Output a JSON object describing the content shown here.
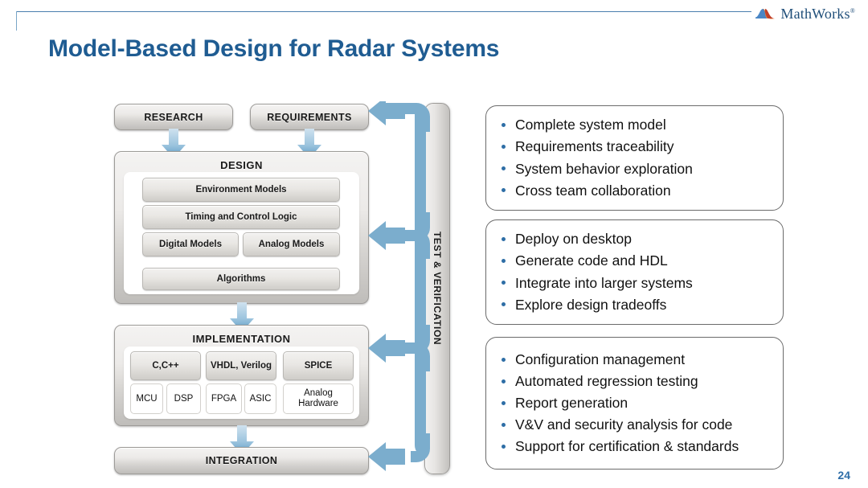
{
  "brand": {
    "name": "MathWorks",
    "trademark": "®",
    "logo_icon": "mathworks-membrane-icon",
    "accent_color": "#1f4e79"
  },
  "title": "Model-Based Design for Radar Systems",
  "page_number": "24",
  "colors": {
    "title": "#1f5c92",
    "arrow_blue": "#7badcd",
    "bullet_blue": "#2e6ea6",
    "box_border": "#9d9b98"
  },
  "diagram": {
    "inputs": [
      {
        "label": "RESEARCH"
      },
      {
        "label": "REQUIREMENTS"
      }
    ],
    "design": {
      "label": "DESIGN",
      "rows": [
        [
          "Environment Models"
        ],
        [
          "Timing and Control Logic"
        ],
        [
          "Digital Models",
          "Analog Models"
        ],
        [
          "Algorithms"
        ]
      ]
    },
    "implementation": {
      "label": "IMPLEMENTATION",
      "languages": [
        "C,C++",
        "VHDL, Verilog",
        "SPICE"
      ],
      "hardware": [
        "MCU",
        "DSP",
        "FPGA",
        "ASIC",
        "Analog\nHardware"
      ],
      "hardware_flat": [
        "MCU",
        "DSP",
        "FPGA",
        "ASIC",
        "Analog Hardware"
      ]
    },
    "integration": {
      "label": "INTEGRATION"
    },
    "verification": {
      "label": "TEST & VERIFICATION"
    },
    "flow_arrows": [
      "research-to-design",
      "requirements-to-design",
      "design-to-implementation",
      "implementation-to-integration"
    ],
    "feedback_arrows": [
      "verify-to-requirements",
      "verify-to-design",
      "verify-to-implementation",
      "verify-to-integration"
    ]
  },
  "panels": [
    {
      "name": "modeling-benefits",
      "bullets": [
        "Complete system model",
        "Requirements traceability",
        "System behavior exploration",
        "Cross team collaboration"
      ]
    },
    {
      "name": "implementation-benefits",
      "bullets": [
        "Deploy on desktop",
        "Generate code and HDL",
        "Integrate into larger systems",
        "Explore design tradeoffs"
      ]
    },
    {
      "name": "verification-benefits",
      "bullets": [
        "Configuration management",
        "Automated regression testing",
        "Report generation",
        "V&V and security analysis for code",
        "Support for certification & standards"
      ]
    }
  ]
}
